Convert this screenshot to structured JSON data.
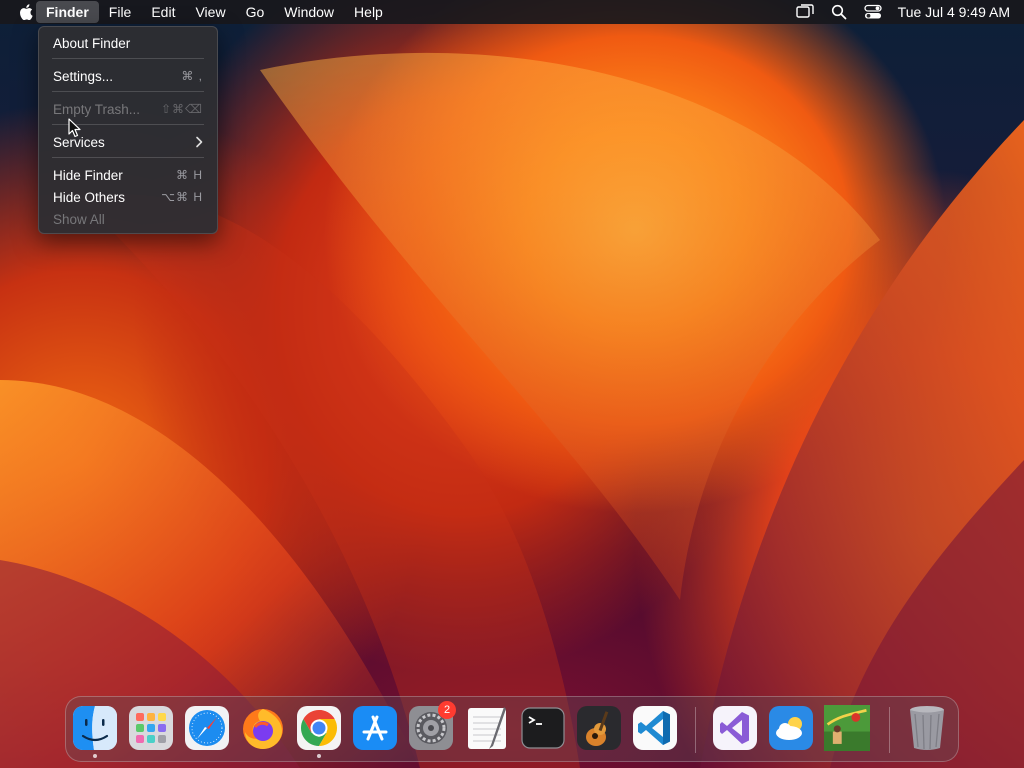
{
  "menubar": {
    "apple_icon": "apple-logo-icon",
    "app_name": "Finder",
    "menus": [
      "File",
      "Edit",
      "View",
      "Go",
      "Window",
      "Help"
    ],
    "status_icons": [
      "screen-mirroring-icon",
      "spotlight-search-icon",
      "control-center-icon"
    ],
    "clock": "Tue Jul 4  9:49 AM"
  },
  "dropdown": {
    "items": [
      {
        "label": "About Finder",
        "shortcut": "",
        "disabled": false
      },
      {
        "label": "Settings...",
        "shortcut": "⌘ ,",
        "disabled": false
      },
      {
        "label": "Empty Trash...",
        "shortcut": "⇧⌘⌫",
        "disabled": true
      },
      {
        "label": "Services",
        "shortcut": "",
        "disabled": false,
        "submenu": true
      },
      {
        "label": "Hide Finder",
        "shortcut": "⌘ H",
        "disabled": false
      },
      {
        "label": "Hide Others",
        "shortcut": "⌥⌘ H",
        "disabled": false
      },
      {
        "label": "Show All",
        "shortcut": "",
        "disabled": true
      }
    ]
  },
  "dock": {
    "apps": [
      {
        "name": "Finder",
        "icon": "finder-icon",
        "running": true
      },
      {
        "name": "Launchpad",
        "icon": "launchpad-icon",
        "running": false
      },
      {
        "name": "Safari",
        "icon": "safari-icon",
        "running": false
      },
      {
        "name": "Firefox",
        "icon": "firefox-icon",
        "running": false
      },
      {
        "name": "Google Chrome",
        "icon": "chrome-icon",
        "running": true
      },
      {
        "name": "App Store",
        "icon": "app-store-icon",
        "running": false
      },
      {
        "name": "System Settings",
        "icon": "system-settings-icon",
        "running": false,
        "badge": "2"
      },
      {
        "name": "TextEdit",
        "icon": "textedit-icon",
        "running": false
      },
      {
        "name": "Terminal",
        "icon": "terminal-icon",
        "running": false
      },
      {
        "name": "GarageBand",
        "icon": "garageband-icon",
        "running": false
      },
      {
        "name": "Visual Studio Code",
        "icon": "vscode-icon",
        "running": false
      },
      {
        "name": "Visual Studio",
        "icon": "visual-studio-icon",
        "running": false
      },
      {
        "name": "Weather",
        "icon": "weather-icon",
        "running": false
      },
      {
        "name": "Game",
        "icon": "game-icon",
        "running": false
      },
      {
        "name": "Trash",
        "icon": "trash-icon",
        "running": false
      }
    ]
  }
}
